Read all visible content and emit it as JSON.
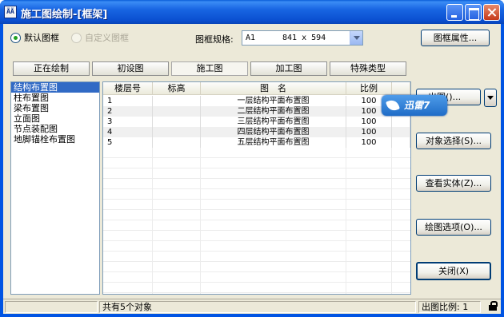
{
  "window": {
    "icon_text": "ÃÃ",
    "title": "施工图绘制-[框架]"
  },
  "options": {
    "radio_default": "默认图框",
    "radio_custom": "自定义图框",
    "frame_spec_label": "图框规格:",
    "frame_spec_value": "A1",
    "frame_spec_size": "841 x 594",
    "frame_props_button": "图框属性..."
  },
  "tabs": [
    "正在绘制",
    "初设图",
    "施工图",
    "加工图",
    "特殊类型"
  ],
  "active_tab": 2,
  "categories": [
    "结构布置图",
    "柱布置图",
    "梁布置图",
    "立面图",
    "节点装配图",
    "地脚锚栓布置图"
  ],
  "selected_category": 0,
  "grid": {
    "headers": [
      "楼层号",
      "标高",
      "图　名",
      "比例"
    ],
    "rows": [
      {
        "floor": "1",
        "elev": "",
        "name": "一层结构平面布置图",
        "scale": "100"
      },
      {
        "floor": "2",
        "elev": "",
        "name": "二层结构平面布置图",
        "scale": "100"
      },
      {
        "floor": "3",
        "elev": "",
        "name": "三层结构平面布置图",
        "scale": "100"
      },
      {
        "floor": "4",
        "elev": "",
        "name": "四层结构平面布置图",
        "scale": "100"
      },
      {
        "floor": "5",
        "elev": "",
        "name": "五层结构平面布置图",
        "scale": "100"
      }
    ]
  },
  "buttons": {
    "draw_partial": "出图(",
    "draw_partial_suffix": ")...",
    "select_objects": "对象选择(S)...",
    "view_entities": "查看实体(Z)...",
    "draw_options": "绘图选项(O)...",
    "close": "关闭(X)"
  },
  "overlay_badge": "迅雷7",
  "status": {
    "count": "共有5个对象",
    "scale_label": "出图比例:",
    "scale_value": "1"
  },
  "colors": {
    "title_bar": "#0a4fd0",
    "selection": "#316ac5",
    "dialog_bg": "#ece9d8"
  }
}
